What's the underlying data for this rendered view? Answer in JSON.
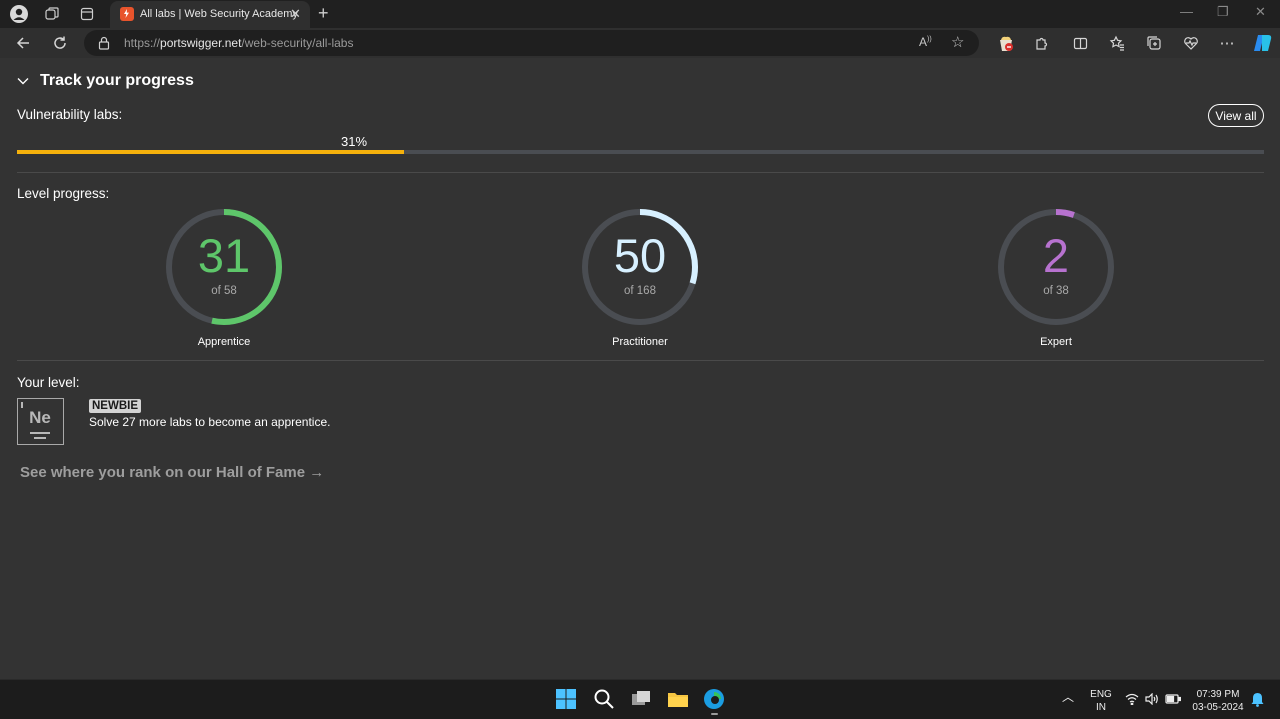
{
  "browser": {
    "tab_title": "All labs | Web Security Academy",
    "url_prefix": "https://",
    "url_host": "portswigger.net",
    "url_path": "/web-security/all-labs"
  },
  "progress": {
    "section_title": "Track your progress",
    "vuln_label": "Vulnerability labs:",
    "view_all": "View all",
    "percent_text": "31%",
    "percent_value": 31,
    "level_label": "Level progress:"
  },
  "levels": [
    {
      "name": "Apprentice",
      "count": "31",
      "of_text": "of 58",
      "solved": 31,
      "total": 58,
      "color": "#5ec66a"
    },
    {
      "name": "Practitioner",
      "count": "50",
      "of_text": "of 168",
      "solved": 50,
      "total": 168,
      "color": "#d7f0ff"
    },
    {
      "name": "Expert",
      "count": "2",
      "of_text": "of 38",
      "solved": 2,
      "total": 38,
      "color": "#b772cf"
    }
  ],
  "your_level": {
    "label": "Your level:",
    "symbol": "Ne",
    "badge": "NEWBIE",
    "message": "Solve 27 more labs to become an apprentice.",
    "hall_of_fame": "See where you rank on our Hall of Fame →"
  },
  "taskbar": {
    "lang_top": "ENG",
    "lang_bottom": "IN",
    "time": "07:39 PM",
    "date": "03-05-2024"
  },
  "colors": {
    "progress_fill": "#f5b10c",
    "ring_track": "#4a4d52"
  }
}
